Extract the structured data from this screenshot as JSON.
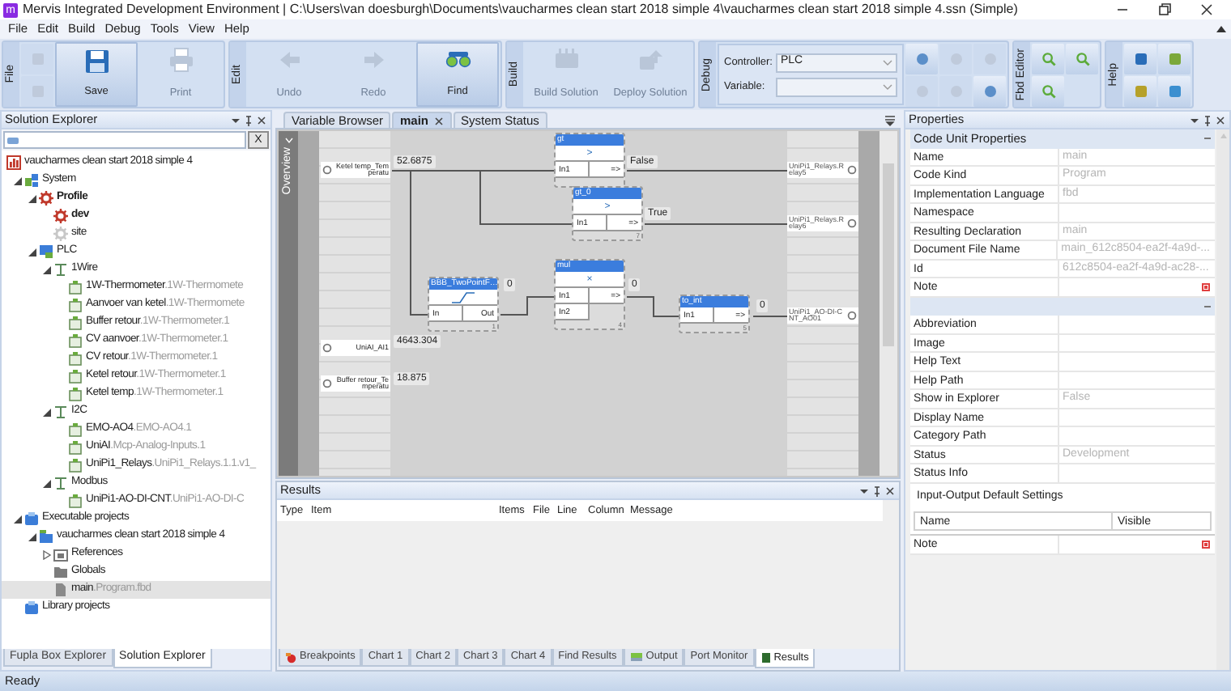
{
  "window": {
    "logo": "m",
    "title": "Mervis Integrated Development Environment | C:\\Users\\van doesburgh\\Documents\\vaucharmes clean start 2018 simple 4\\vaucharmes clean start 2018 simple 4.ssn (Simple)"
  },
  "menu": [
    "File",
    "Edit",
    "Build",
    "Debug",
    "Tools",
    "View",
    "Help"
  ],
  "ribbon": {
    "groups": [
      {
        "label": "File",
        "kind": "buttons",
        "small": [
          {
            "disabled": true
          },
          {
            "disabled": true
          }
        ],
        "buttons": [
          {
            "label": "Save",
            "disabled": false
          },
          {
            "label": "Print",
            "disabled": true
          }
        ]
      },
      {
        "label": "Edit",
        "kind": "buttons",
        "buttons": [
          {
            "label": "Undo",
            "disabled": true
          },
          {
            "label": "Redo",
            "disabled": true
          },
          {
            "label": "Find",
            "disabled": false
          }
        ]
      },
      {
        "label": "Build",
        "kind": "buttons",
        "buttons": [
          {
            "label": "Build Solution",
            "disabled": true
          },
          {
            "label": "Deploy Solution",
            "disabled": true
          }
        ]
      },
      {
        "label": "Debug",
        "kind": "debug",
        "fields": [
          {
            "label": "Controller:",
            "value": "PLC"
          },
          {
            "label": "Variable:"
          }
        ],
        "small": [
          {
            "disabled": false
          },
          {
            "disabled": true
          },
          {
            "disabled": true
          },
          {
            "disabled": true
          },
          {
            "disabled": true
          },
          {
            "disabled": false
          }
        ]
      },
      {
        "label": "Fbd Editor",
        "kind": "icons",
        "small": [
          {
            "disabled": false
          },
          {
            "disabled": false
          },
          {
            "disabled": false
          }
        ]
      },
      {
        "label": "Help",
        "kind": "icons",
        "small": [
          {
            "disabled": false
          },
          {
            "disabled": false
          },
          {
            "disabled": false
          },
          {
            "disabled": false
          }
        ]
      }
    ]
  },
  "solution_explorer": {
    "title": "Solution Explorer",
    "clear_label": "X",
    "tree": [
      {
        "label": "vaucharmes clean start 2018 simple 4",
        "kind": "solution",
        "selected": false,
        "children": [
          {
            "label": "System",
            "kind": "system",
            "expanded": true,
            "selected": false,
            "children": [
              {
                "label": "Profile",
                "kind": "profile",
                "active": true,
                "expanded": true,
                "selected": false,
                "children": [
                  {
                    "label": "dev",
                    "kind": "config",
                    "active": true,
                    "selected": false
                  },
                  {
                    "label": "site",
                    "kind": "config",
                    "active": false,
                    "selected": false
                  }
                ]
              },
              {
                "label": "PLC",
                "kind": "plc",
                "active": false,
                "expanded": true,
                "selected": false,
                "children": [
                  {
                    "label": "1Wire",
                    "kind": "bus",
                    "expanded": true,
                    "selected": false,
                    "children": [
                      {
                        "label": "1W-Thermometer",
                        "detail": ".1W-Thermomete",
                        "kind": "device",
                        "selected": false
                      },
                      {
                        "label": "Aanvoer van ketel",
                        "detail": ".1W-Thermomete",
                        "kind": "device",
                        "selected": false
                      },
                      {
                        "label": "Buffer retour",
                        "detail": ".1W-Thermometer.1",
                        "kind": "device",
                        "selected": false
                      },
                      {
                        "label": "CV aanvoer",
                        "detail": ".1W-Thermometer.1",
                        "kind": "device",
                        "selected": false
                      },
                      {
                        "label": "CV retour",
                        "detail": ".1W-Thermometer.1",
                        "kind": "device",
                        "selected": false
                      },
                      {
                        "label": "Ketel retour",
                        "detail": ".1W-Thermometer.1",
                        "kind": "device",
                        "selected": false
                      },
                      {
                        "label": "Ketel temp",
                        "detail": ".1W-Thermometer.1",
                        "kind": "device",
                        "selected": false
                      }
                    ]
                  },
                  {
                    "label": "I2C",
                    "kind": "bus",
                    "expanded": true,
                    "selected": false,
                    "children": [
                      {
                        "label": "EMO-AO4",
                        "detail": ".EMO-AO4.1",
                        "kind": "device",
                        "selected": false
                      },
                      {
                        "label": "UniAI",
                        "detail": ".Mcp-Analog-Inputs.1",
                        "kind": "device",
                        "selected": false
                      },
                      {
                        "label": "UniPi1_Relays",
                        "detail": ".UniPi1_Relays.1.1.v1_",
                        "kind": "device",
                        "selected": false
                      }
                    ]
                  },
                  {
                    "label": "Modbus",
                    "kind": "bus",
                    "expanded": true,
                    "selected": false,
                    "children": [
                      {
                        "label": "UniPi1-AO-DI-CNT",
                        "detail": ".UniPi1-AO-DI-C",
                        "kind": "device",
                        "selected": false
                      }
                    ]
                  }
                ]
              }
            ]
          },
          {
            "label": "Executable projects",
            "kind": "projects",
            "expanded": true,
            "selected": false,
            "children": [
              {
                "label": "vaucharmes clean start 2018 simple 4",
                "kind": "project",
                "expanded": true,
                "selected": false,
                "children": [
                  {
                    "label": "References",
                    "kind": "references",
                    "expanded": false,
                    "selected": false
                  },
                  {
                    "label": "Globals",
                    "kind": "folder",
                    "selected": false
                  },
                  {
                    "label": "main",
                    "detail": ".Program.fbd",
                    "kind": "file",
                    "selected": true
                  }
                ]
              }
            ]
          },
          {
            "label": "Library projects",
            "kind": "library",
            "selected": false
          }
        ]
      }
    ],
    "tabs": [
      {
        "label": "Fupla Box Explorer",
        "selected": false
      },
      {
        "label": "Solution Explorer",
        "selected": true
      }
    ]
  },
  "editor": {
    "tabs": [
      {
        "label": "Variable Browser",
        "selected": false
      },
      {
        "label": "main",
        "selected": true,
        "closable": true
      },
      {
        "label": "System Status",
        "selected": false
      }
    ],
    "overview": "Overview",
    "inputs": [
      {
        "label": "Ketel temp_Temperatu",
        "value": "52.6875"
      },
      {
        "label": "UniAI_AI1",
        "value": "4643.304"
      },
      {
        "label": "Buffer retour_Temperatu",
        "value": "18.875"
      }
    ],
    "outputs": [
      {
        "label": "UniPi1_Relays.Relay5"
      },
      {
        "label": "UniPi1_Relays.Relay6"
      },
      {
        "label": "UniPi1_AO-DI-CNT_AO01"
      }
    ],
    "blocks": [
      {
        "title": "gt",
        "kind": "operator",
        "symbol": ">",
        "inputs": [
          "In1"
        ],
        "output": "=>",
        "value": "False"
      },
      {
        "title": "gt_0",
        "kind": "operator",
        "symbol": ">",
        "inputs": [
          "In1"
        ],
        "output": "=>",
        "value": "True",
        "order": "7"
      },
      {
        "title": "BBB_TwoPointF…",
        "kind": "curve",
        "inputs": [
          "In"
        ],
        "output": "Out",
        "value": "0",
        "order": "1"
      },
      {
        "title": "mul",
        "kind": "operator",
        "symbol": "×",
        "inputs": [
          "In1",
          "In2"
        ],
        "output": "=>",
        "value": "0",
        "order": "4"
      },
      {
        "title": "to_int",
        "kind": "blank",
        "inputs": [
          "In1"
        ],
        "output": "=>",
        "value": "0",
        "order": "5"
      }
    ]
  },
  "results": {
    "title": "Results",
    "columns": [
      "Type",
      "Item",
      "Items",
      "File",
      "Line",
      "Column",
      "Message"
    ],
    "tabs": [
      {
        "label": "Breakpoints",
        "selected": false
      },
      {
        "label": "Chart 1",
        "selected": false
      },
      {
        "label": "Chart 2",
        "selected": false
      },
      {
        "label": "Chart 3",
        "selected": false
      },
      {
        "label": "Chart 4",
        "selected": false
      },
      {
        "label": "Find Results",
        "selected": false
      },
      {
        "label": "Output",
        "selected": false
      },
      {
        "label": "Port Monitor",
        "selected": false
      },
      {
        "label": "Results",
        "selected": true
      }
    ]
  },
  "properties": {
    "title": "Properties",
    "categories": [
      {
        "label": "Code Unit Properties",
        "expanded": true,
        "rows": [
          {
            "name": "Name",
            "value": "main",
            "kind": "text"
          },
          {
            "name": "Code Kind",
            "value": "Program",
            "kind": "text"
          },
          {
            "name": "Implementation Language",
            "value": "fbd",
            "kind": "text"
          },
          {
            "name": "Namespace",
            "kind": "text"
          },
          {
            "name": "Resulting Declaration",
            "value": "main",
            "kind": "text"
          },
          {
            "name": "Document File Name",
            "value": "main_612c8504-ea2f-4a9d-...",
            "kind": "text"
          },
          {
            "name": "Id",
            "value": "612c8504-ea2f-4a9d-ac28-...",
            "kind": "text"
          },
          {
            "name": "Note",
            "kind": "note"
          }
        ]
      },
      {
        "expanded": true,
        "rows": [
          {
            "name": "Abbreviation",
            "kind": "text"
          },
          {
            "name": "Image",
            "kind": "text"
          },
          {
            "name": "Help Text",
            "kind": "text"
          },
          {
            "name": "Help Path",
            "kind": "text"
          },
          {
            "name": "Show in Explorer",
            "value": "False",
            "kind": "text"
          },
          {
            "name": "Display Name",
            "kind": "text"
          },
          {
            "name": "Category Path",
            "kind": "text"
          },
          {
            "name": "Status",
            "value": "Development",
            "kind": "text"
          },
          {
            "name": "Status Info",
            "kind": "text"
          }
        ]
      }
    ],
    "io_settings": {
      "title": "Input-Output Default Settings",
      "columns": [
        "Name",
        "Visible"
      ]
    },
    "note_row": {
      "name": "Note",
      "kind": "note"
    }
  },
  "status_bar": "Ready"
}
